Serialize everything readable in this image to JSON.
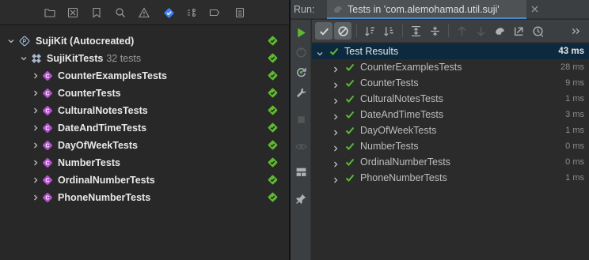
{
  "navigator": {
    "toolbar_icons": [
      "folder-icon",
      "source-control-icon",
      "bookmark-icon",
      "search-icon",
      "warning-icon",
      "test-icon",
      "debug-icon",
      "breakpoint-icon",
      "report-icon"
    ],
    "active_icon": "test-icon",
    "tree": [
      {
        "id": "suji",
        "label": "SujiKit (Autocreated)",
        "sub": "",
        "kind": "plan",
        "level": 0,
        "status": "passed"
      },
      {
        "id": "sujikit-tests",
        "label": "SujiKitTests",
        "sub": "32 tests",
        "kind": "bundle",
        "level": 1,
        "status": "passed"
      },
      {
        "id": "counter-examples",
        "label": "CounterExamplesTests",
        "sub": "",
        "kind": "class",
        "level": 2,
        "status": "passed"
      },
      {
        "id": "counter",
        "label": "CounterTests",
        "sub": "",
        "kind": "class",
        "level": 2,
        "status": "passed"
      },
      {
        "id": "cultural",
        "label": "CulturalNotesTests",
        "sub": "",
        "kind": "class",
        "level": 2,
        "status": "passed"
      },
      {
        "id": "datetime",
        "label": "DateAndTimeTests",
        "sub": "",
        "kind": "class",
        "level": 2,
        "status": "passed"
      },
      {
        "id": "dayofweek",
        "label": "DayOfWeekTests",
        "sub": "",
        "kind": "class",
        "level": 2,
        "status": "passed"
      },
      {
        "id": "number",
        "label": "NumberTests",
        "sub": "",
        "kind": "class",
        "level": 2,
        "status": "passed"
      },
      {
        "id": "ordinal",
        "label": "OrdinalNumberTests",
        "sub": "",
        "kind": "class",
        "level": 2,
        "status": "passed"
      },
      {
        "id": "phone",
        "label": "PhoneNumberTests",
        "sub": "",
        "kind": "class",
        "level": 2,
        "status": "passed"
      }
    ]
  },
  "run_panel": {
    "run_label": "Run:",
    "tab_label": "Tests in 'com.alemohamad.util.suji'",
    "colors": {
      "pass": "#5fb832",
      "accent": "#4a88c7",
      "selected_row": "#0d293e"
    },
    "results": [
      {
        "label": "Test Results",
        "time": "43 ms",
        "root": true
      },
      {
        "label": "CounterExamplesTests",
        "time": "28 ms"
      },
      {
        "label": "CounterTests",
        "time": "9 ms"
      },
      {
        "label": "CulturalNotesTests",
        "time": "1 ms"
      },
      {
        "label": "DateAndTimeTests",
        "time": "3 ms"
      },
      {
        "label": "DayOfWeekTests",
        "time": "1 ms"
      },
      {
        "label": "NumberTests",
        "time": "0 ms"
      },
      {
        "label": "OrdinalNumberTests",
        "time": "0 ms"
      },
      {
        "label": "PhoneNumberTests",
        "time": "1 ms"
      }
    ]
  }
}
